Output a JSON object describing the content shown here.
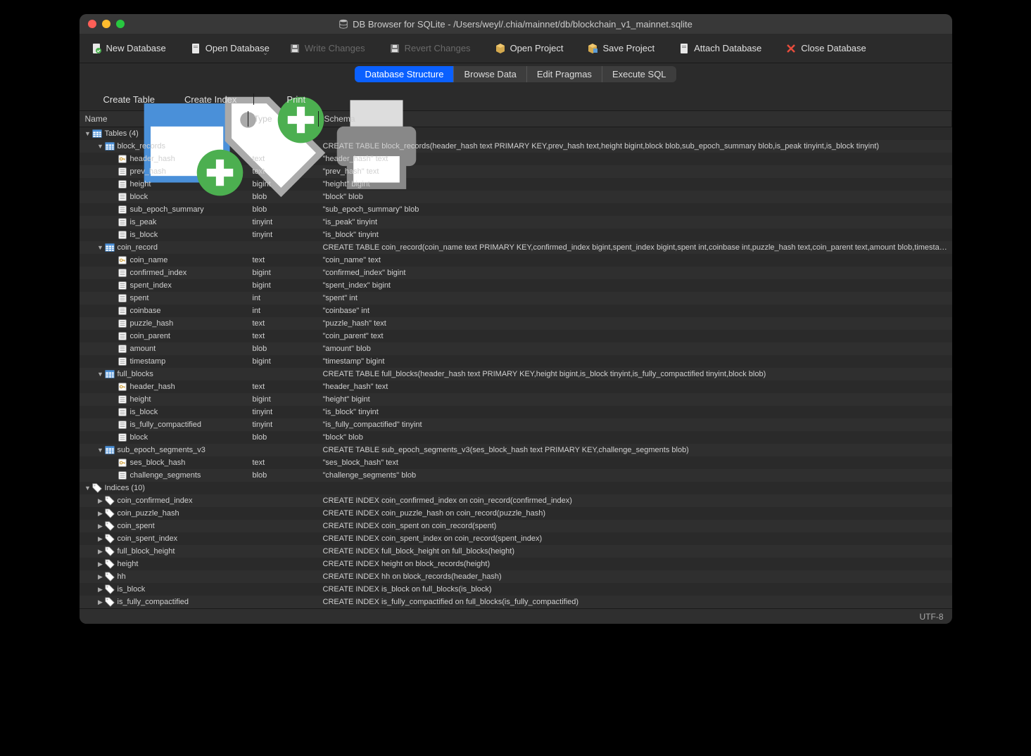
{
  "window": {
    "title": "DB Browser for SQLite - /Users/weyl/.chia/mainnet/db/blockchain_v1_mainnet.sqlite"
  },
  "toolbar": {
    "new_db": "New Database",
    "open_db": "Open Database",
    "write_changes": "Write Changes",
    "revert_changes": "Revert Changes",
    "open_project": "Open Project",
    "save_project": "Save Project",
    "attach_db": "Attach Database",
    "close_db": "Close Database"
  },
  "tabs": {
    "structure": "Database Structure",
    "browse": "Browse Data",
    "pragmas": "Edit Pragmas",
    "sql": "Execute SQL"
  },
  "subtoolbar": {
    "create_table": "Create Table",
    "create_index": "Create Index",
    "print": "Print"
  },
  "headers": {
    "name": "Name",
    "type": "Type",
    "schema": "Schema"
  },
  "statusbar": {
    "encoding": "UTF-8"
  },
  "tree": [
    {
      "indent": 0,
      "disclose": "down",
      "icon": "table-group",
      "name": "Tables (4)",
      "type": "",
      "schema": ""
    },
    {
      "indent": 1,
      "disclose": "down",
      "icon": "table",
      "name": "block_records",
      "type": "",
      "schema": "CREATE TABLE block_records(header_hash text PRIMARY KEY,prev_hash text,height bigint,block blob,sub_epoch_summary blob,is_peak tinyint,is_block tinyint)"
    },
    {
      "indent": 2,
      "disclose": "",
      "icon": "key",
      "name": "header_hash",
      "type": "text",
      "schema": "\"header_hash\" text"
    },
    {
      "indent": 2,
      "disclose": "",
      "icon": "col",
      "name": "prev_hash",
      "type": "text",
      "schema": "\"prev_hash\" text"
    },
    {
      "indent": 2,
      "disclose": "",
      "icon": "col",
      "name": "height",
      "type": "bigint",
      "schema": "\"height\" bigint"
    },
    {
      "indent": 2,
      "disclose": "",
      "icon": "col",
      "name": "block",
      "type": "blob",
      "schema": "\"block\" blob"
    },
    {
      "indent": 2,
      "disclose": "",
      "icon": "col",
      "name": "sub_epoch_summary",
      "type": "blob",
      "schema": "\"sub_epoch_summary\" blob"
    },
    {
      "indent": 2,
      "disclose": "",
      "icon": "col",
      "name": "is_peak",
      "type": "tinyint",
      "schema": "\"is_peak\" tinyint"
    },
    {
      "indent": 2,
      "disclose": "",
      "icon": "col",
      "name": "is_block",
      "type": "tinyint",
      "schema": "\"is_block\" tinyint"
    },
    {
      "indent": 1,
      "disclose": "down",
      "icon": "table",
      "name": "coin_record",
      "type": "",
      "schema": "CREATE TABLE coin_record(coin_name text PRIMARY KEY,confirmed_index bigint,spent_index bigint,spent int,coinbase int,puzzle_hash text,coin_parent text,amount blob,timestamp bigint)"
    },
    {
      "indent": 2,
      "disclose": "",
      "icon": "key",
      "name": "coin_name",
      "type": "text",
      "schema": "\"coin_name\" text"
    },
    {
      "indent": 2,
      "disclose": "",
      "icon": "col",
      "name": "confirmed_index",
      "type": "bigint",
      "schema": "\"confirmed_index\" bigint"
    },
    {
      "indent": 2,
      "disclose": "",
      "icon": "col",
      "name": "spent_index",
      "type": "bigint",
      "schema": "\"spent_index\" bigint"
    },
    {
      "indent": 2,
      "disclose": "",
      "icon": "col",
      "name": "spent",
      "type": "int",
      "schema": "\"spent\" int"
    },
    {
      "indent": 2,
      "disclose": "",
      "icon": "col",
      "name": "coinbase",
      "type": "int",
      "schema": "\"coinbase\" int"
    },
    {
      "indent": 2,
      "disclose": "",
      "icon": "col",
      "name": "puzzle_hash",
      "type": "text",
      "schema": "\"puzzle_hash\" text"
    },
    {
      "indent": 2,
      "disclose": "",
      "icon": "col",
      "name": "coin_parent",
      "type": "text",
      "schema": "\"coin_parent\" text"
    },
    {
      "indent": 2,
      "disclose": "",
      "icon": "col",
      "name": "amount",
      "type": "blob",
      "schema": "\"amount\" blob"
    },
    {
      "indent": 2,
      "disclose": "",
      "icon": "col",
      "name": "timestamp",
      "type": "bigint",
      "schema": "\"timestamp\" bigint"
    },
    {
      "indent": 1,
      "disclose": "down",
      "icon": "table",
      "name": "full_blocks",
      "type": "",
      "schema": "CREATE TABLE full_blocks(header_hash text PRIMARY KEY,height bigint,is_block tinyint,is_fully_compactified tinyint,block blob)"
    },
    {
      "indent": 2,
      "disclose": "",
      "icon": "key",
      "name": "header_hash",
      "type": "text",
      "schema": "\"header_hash\" text"
    },
    {
      "indent": 2,
      "disclose": "",
      "icon": "col",
      "name": "height",
      "type": "bigint",
      "schema": "\"height\" bigint"
    },
    {
      "indent": 2,
      "disclose": "",
      "icon": "col",
      "name": "is_block",
      "type": "tinyint",
      "schema": "\"is_block\" tinyint"
    },
    {
      "indent": 2,
      "disclose": "",
      "icon": "col",
      "name": "is_fully_compactified",
      "type": "tinyint",
      "schema": "\"is_fully_compactified\" tinyint"
    },
    {
      "indent": 2,
      "disclose": "",
      "icon": "col",
      "name": "block",
      "type": "blob",
      "schema": "\"block\" blob"
    },
    {
      "indent": 1,
      "disclose": "down",
      "icon": "table",
      "name": "sub_epoch_segments_v3",
      "type": "",
      "schema": "CREATE TABLE sub_epoch_segments_v3(ses_block_hash text PRIMARY KEY,challenge_segments blob)"
    },
    {
      "indent": 2,
      "disclose": "",
      "icon": "key",
      "name": "ses_block_hash",
      "type": "text",
      "schema": "\"ses_block_hash\" text"
    },
    {
      "indent": 2,
      "disclose": "",
      "icon": "col",
      "name": "challenge_segments",
      "type": "blob",
      "schema": "\"challenge_segments\" blob"
    },
    {
      "indent": 0,
      "disclose": "down",
      "icon": "index-group",
      "name": "Indices (10)",
      "type": "",
      "schema": ""
    },
    {
      "indent": 1,
      "disclose": "right",
      "icon": "index",
      "name": "coin_confirmed_index",
      "type": "",
      "schema": "CREATE INDEX coin_confirmed_index on coin_record(confirmed_index)"
    },
    {
      "indent": 1,
      "disclose": "right",
      "icon": "index",
      "name": "coin_puzzle_hash",
      "type": "",
      "schema": "CREATE INDEX coin_puzzle_hash on coin_record(puzzle_hash)"
    },
    {
      "indent": 1,
      "disclose": "right",
      "icon": "index",
      "name": "coin_spent",
      "type": "",
      "schema": "CREATE INDEX coin_spent on coin_record(spent)"
    },
    {
      "indent": 1,
      "disclose": "right",
      "icon": "index",
      "name": "coin_spent_index",
      "type": "",
      "schema": "CREATE INDEX coin_spent_index on coin_record(spent_index)"
    },
    {
      "indent": 1,
      "disclose": "right",
      "icon": "index",
      "name": "full_block_height",
      "type": "",
      "schema": "CREATE INDEX full_block_height on full_blocks(height)"
    },
    {
      "indent": 1,
      "disclose": "right",
      "icon": "index",
      "name": "height",
      "type": "",
      "schema": "CREATE INDEX height on block_records(height)"
    },
    {
      "indent": 1,
      "disclose": "right",
      "icon": "index",
      "name": "hh",
      "type": "",
      "schema": "CREATE INDEX hh on block_records(header_hash)"
    },
    {
      "indent": 1,
      "disclose": "right",
      "icon": "index",
      "name": "is_block",
      "type": "",
      "schema": "CREATE INDEX is_block on full_blocks(is_block)"
    },
    {
      "indent": 1,
      "disclose": "right",
      "icon": "index",
      "name": "is_fully_compactified",
      "type": "",
      "schema": "CREATE INDEX is_fully_compactified on full_blocks(is_fully_compactified)"
    }
  ]
}
